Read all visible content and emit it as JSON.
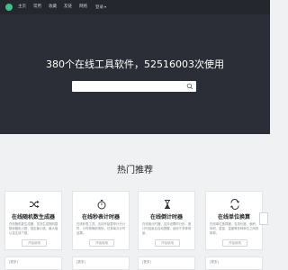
{
  "nav": {
    "items": [
      {
        "label": "主页"
      },
      {
        "label": "常用"
      },
      {
        "label": "收藏"
      },
      {
        "label": "友链"
      },
      {
        "label": "网络"
      },
      {
        "label": "登录"
      }
    ]
  },
  "hero": {
    "title": "380个在线工具软件，52516003次使用",
    "search_placeholder": ""
  },
  "section": {
    "title": "热门推荐"
  },
  "cards": [
    {
      "icon": "shuffle-icon",
      "title": "在线随机数生成器",
      "desc": "在线随机数生成器，支持生成随机整数和随机小数，指定最小值、最大值以及生成个数。",
      "button": "开始使用"
    },
    {
      "icon": "stopwatch-icon",
      "title": "在线秒表计时器",
      "desc": "在线秒表工具，支持开始暂停计分计时，计时精确到毫秒，记录每次计时结果。",
      "button": "开始使用"
    },
    {
      "icon": "hourglass-icon",
      "title": "在线倒计时器",
      "desc": "在线倒计时器，支持设置时分秒，倒计时结束后自动提醒，适用于多种场景。",
      "button": "开始使用"
    },
    {
      "icon": "swap-icon",
      "title": "在线单位换算",
      "desc": "在线单位换算器，支持长度、面积、体积、重量、温度等多种单位之间的换算。",
      "button": "开始使用"
    }
  ],
  "bottom_cards": [
    {
      "label": "[更多]"
    },
    {
      "label": "[更多]"
    },
    {
      "label": "[更多]"
    },
    {
      "label": "[更多]"
    }
  ],
  "colors": {
    "hero_bg": "#2b2e36",
    "nav_bg": "#25272e",
    "accent": "#3fbf8a",
    "page_bg": "#f0f1f3"
  }
}
